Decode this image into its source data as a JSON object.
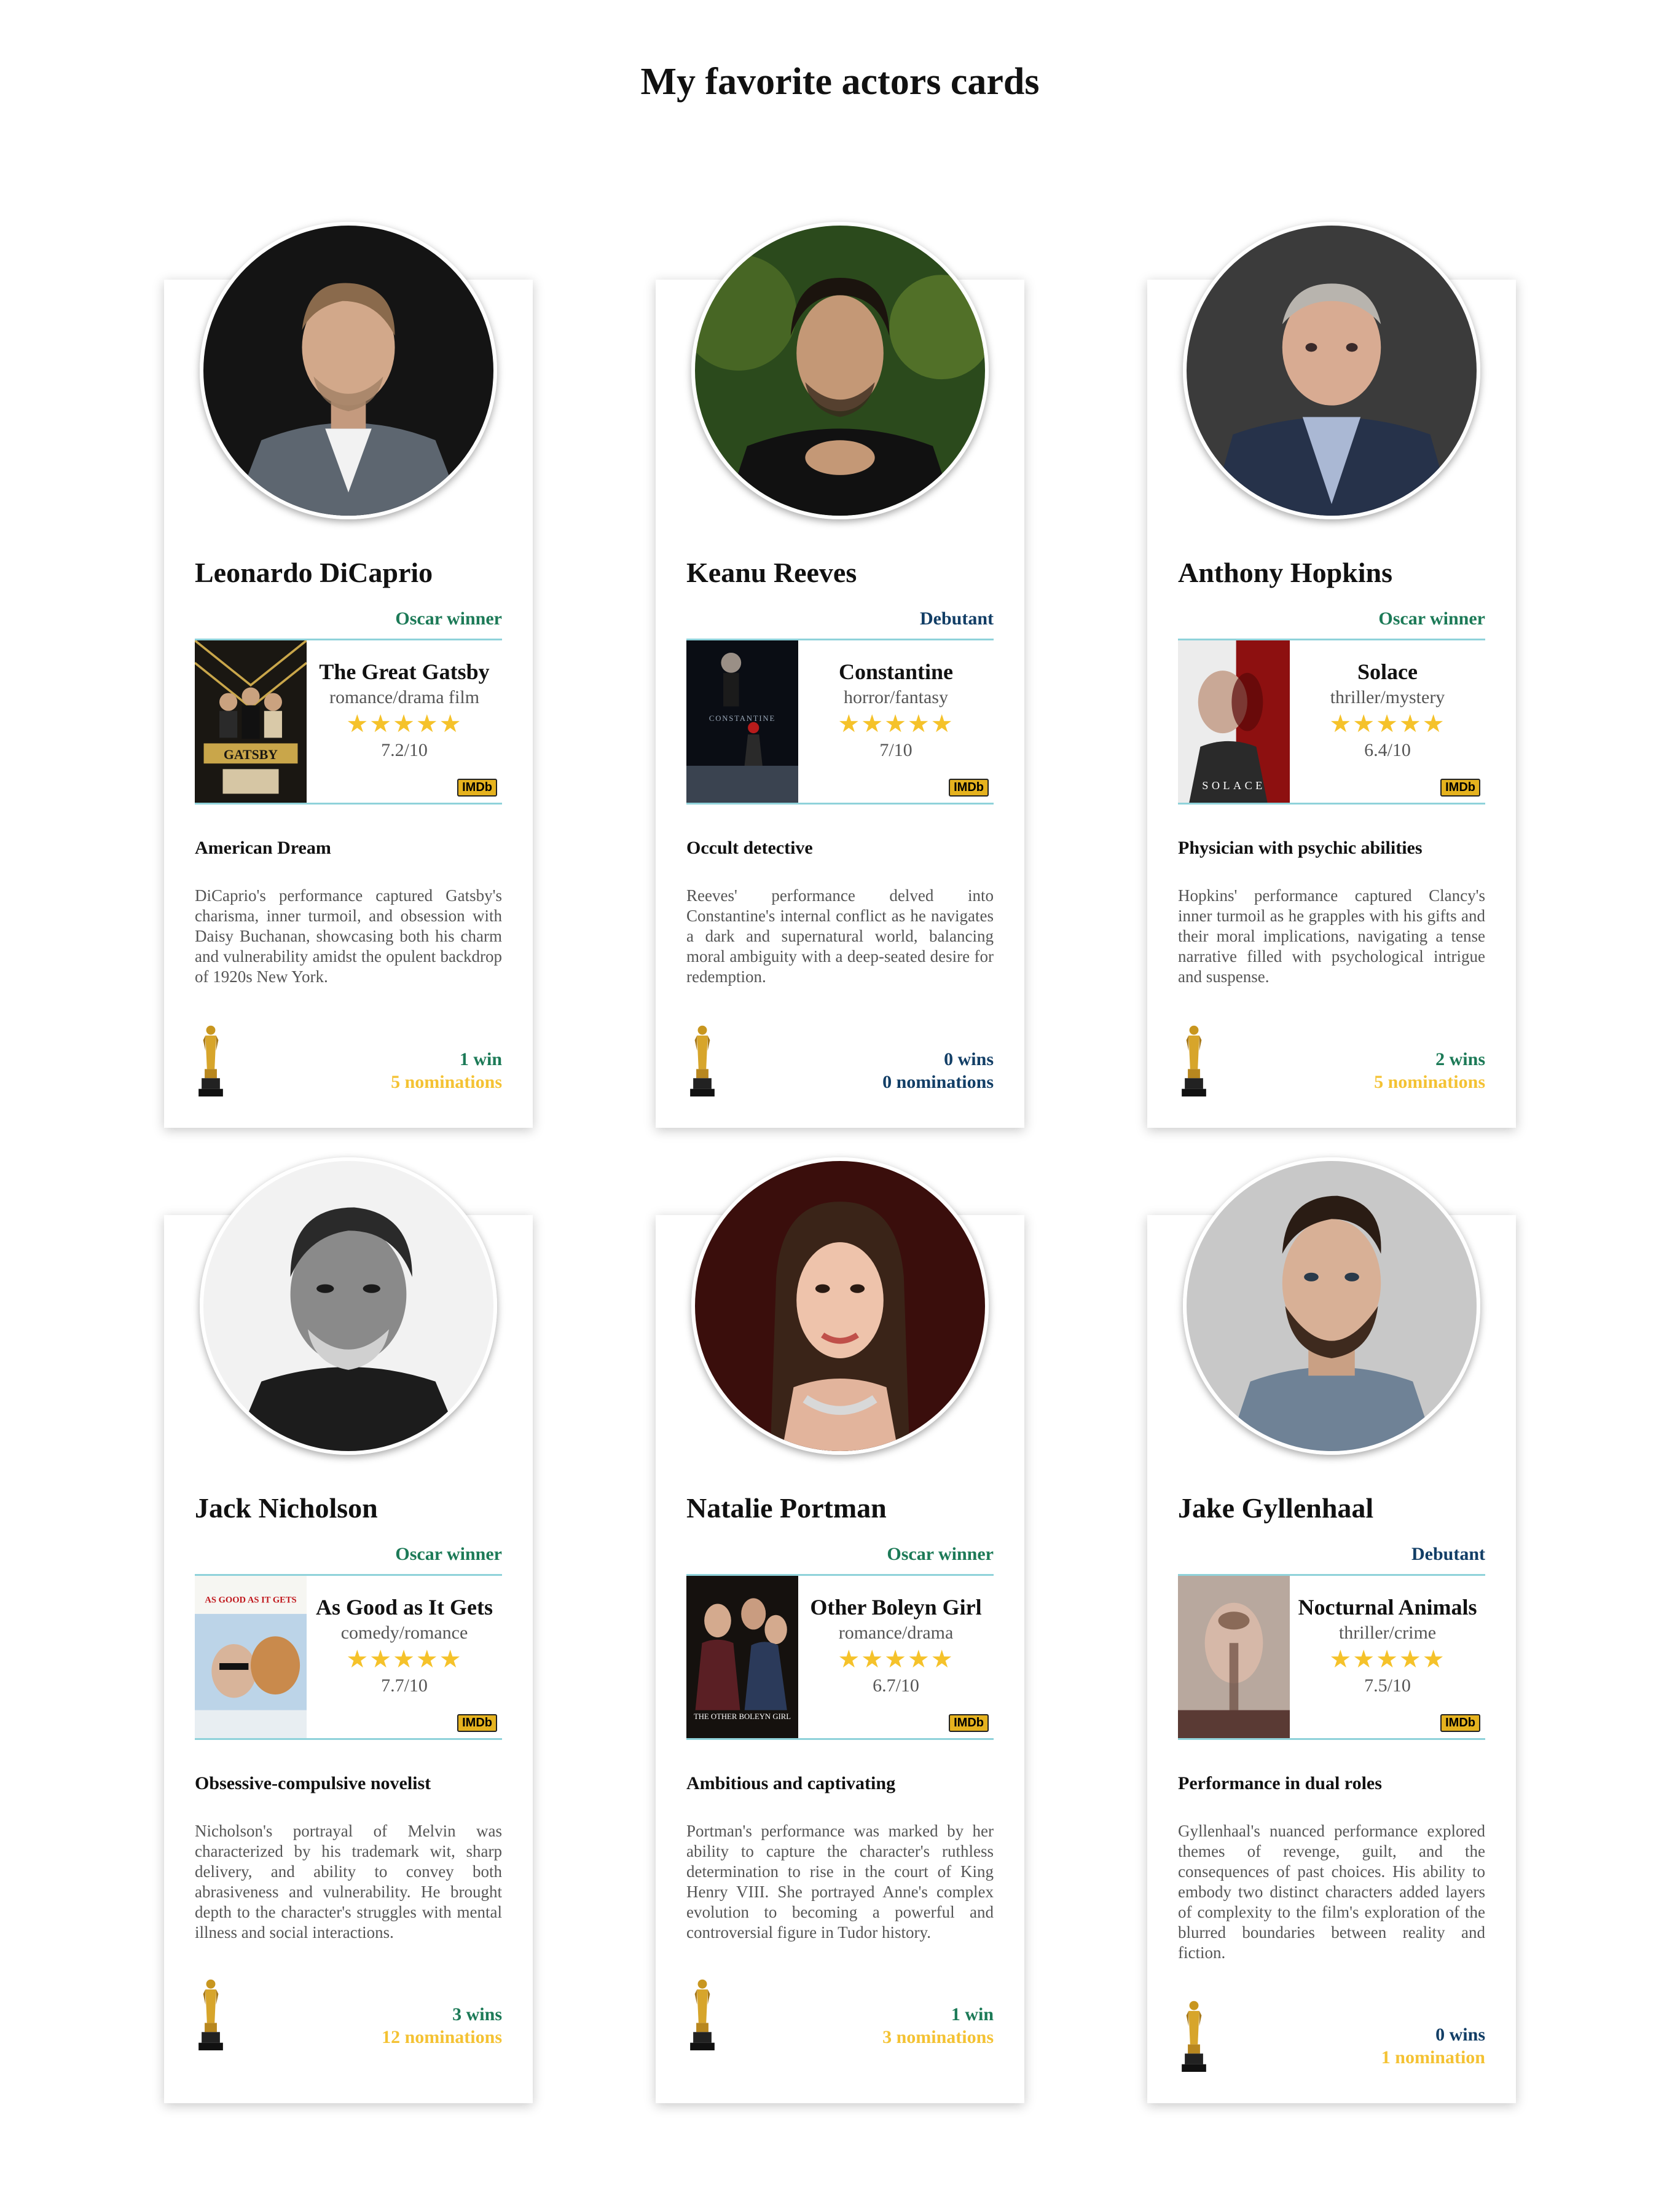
{
  "page": {
    "title": "My favorite actors cards"
  },
  "colors": {
    "oscar_winner": "#1c7a57",
    "debutant": "#123e66",
    "stars": "#f5c22a",
    "nominations": "#f4c233",
    "divider": "#8fd2da",
    "imdb": "#e5b21e"
  },
  "imdb_label": "IMDb",
  "cards": [
    {
      "name": "Leonardo DiCaprio",
      "status": "Oscar winner",
      "movie": {
        "title": "The Great Gatsby",
        "genre": "romance/drama film",
        "stars": "★★★★★",
        "rating": "7.2/10",
        "poster_text": "GATSBY"
      },
      "role": "American Dream",
      "description": "DiCaprio's performance captured Gatsby's charisma, inner turmoil, and obsession with Daisy Buchanan, showcasing both his charm and vulnerability amidst the opulent backdrop of 1920s New York.",
      "wins": "1 win",
      "nominations": "5 nominations"
    },
    {
      "name": "Keanu Reeves",
      "status": "Debutant",
      "movie": {
        "title": "Constantine",
        "genre": "horror/fantasy",
        "stars": "★★★★★",
        "rating": "7/10",
        "poster_text": "CONSTANTINE"
      },
      "role": "Occult detective",
      "description": "Reeves' performance delved into Constantine's internal conflict as he navigates a dark and supernatural world, balancing moral ambiguity with a deep-seated desire for redemption.",
      "wins": "0 wins",
      "nominations": "0 nominations"
    },
    {
      "name": "Anthony Hopkins",
      "status": "Oscar winner",
      "movie": {
        "title": "Solace",
        "genre": "thriller/mystery",
        "stars": "★★★★★",
        "rating": "6.4/10",
        "poster_text": "SOLACE"
      },
      "role": "Physician with psychic abilities",
      "description": "Hopkins' performance captured Clancy's inner turmoil as he grapples with his gifts and their moral implications, navigating a tense narrative filled with psychological intrigue and suspense.",
      "wins": "2 wins",
      "nominations": "5 nominations"
    },
    {
      "name": "Jack Nicholson",
      "status": "Oscar winner",
      "movie": {
        "title": "As Good as It Gets",
        "genre": "comedy/romance",
        "stars": "★★★★★",
        "rating": "7.7/10",
        "poster_text": "AS GOOD AS IT GETS"
      },
      "role": "Obsessive-compulsive novelist",
      "description": "Nicholson's portrayal of Melvin was characterized by his trademark wit, sharp delivery, and ability to convey both abrasiveness and vulnerability. He brought depth to the character's struggles with mental illness and social interactions.",
      "wins": "3 wins",
      "nominations": "12 nominations"
    },
    {
      "name": "Natalie Portman",
      "status": "Oscar winner",
      "movie": {
        "title": "Other Boleyn Girl",
        "genre": "romance/drama",
        "stars": "★★★★★",
        "rating": "6.7/10",
        "poster_text": "THE OTHER BOLEYN GIRL"
      },
      "role": "Ambitious and captivating",
      "description": "Portman's performance was marked by her ability to capture the character's ruthless determination to rise in the court of King Henry VIII. She portrayed Anne's complex evolution to becoming a powerful and controversial figure in Tudor history.",
      "wins": "1 win",
      "nominations": "3 nominations"
    },
    {
      "name": "Jake Gyllenhaal",
      "status": "Debutant",
      "movie": {
        "title": "Nocturnal Animals",
        "genre": "thriller/crime",
        "stars": "★★★★★",
        "rating": "7.5/10",
        "poster_text": ""
      },
      "role": "Performance in dual roles",
      "description": "Gyllenhaal's nuanced performance explored themes of revenge, guilt, and the consequences of past choices. His ability to embody two distinct characters added layers of complexity to the film's exploration of the blurred boundaries between reality and fiction.",
      "wins": "0 wins",
      "nominations": "1 nomination"
    }
  ]
}
